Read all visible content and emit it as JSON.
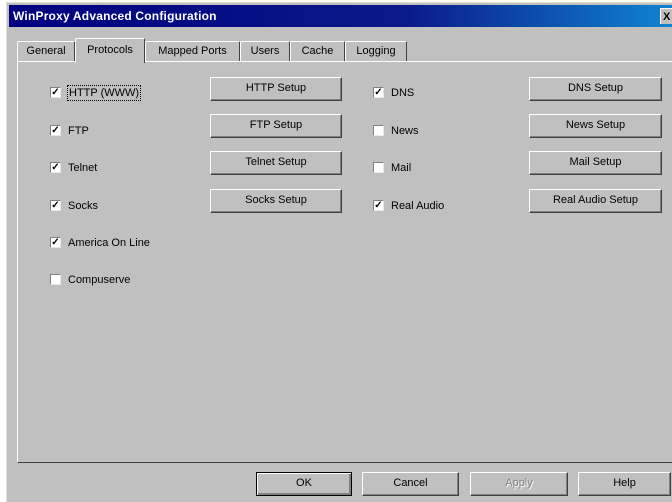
{
  "window": {
    "title": "WinProxy Advanced Configuration",
    "close_label": "X"
  },
  "tabs": [
    "General",
    "Protocols",
    "Mapped Ports",
    "Users",
    "Cache",
    "Logging"
  ],
  "protocols_left": [
    {
      "label": "HTTP (WWW)",
      "checked": true
    },
    {
      "label": "FTP",
      "checked": true
    },
    {
      "label": "Telnet",
      "checked": true
    },
    {
      "label": "Socks",
      "checked": true
    },
    {
      "label": "America On Line",
      "checked": true
    },
    {
      "label": "Compuserve",
      "checked": false
    }
  ],
  "setup_left": [
    "HTTP Setup",
    "FTP Setup",
    "Telnet Setup",
    "Socks Setup"
  ],
  "protocols_right": [
    {
      "label": "DNS",
      "checked": true
    },
    {
      "label": "News",
      "checked": false
    },
    {
      "label": "Mail",
      "checked": false
    },
    {
      "label": "Real Audio",
      "checked": true
    }
  ],
  "setup_right": [
    "DNS Setup",
    "News Setup",
    "Mail Setup",
    "Real Audio Setup"
  ],
  "footer": {
    "ok": "OK",
    "cancel": "Cancel",
    "apply": "Apply",
    "help": "Help"
  },
  "checkmark": "✓"
}
